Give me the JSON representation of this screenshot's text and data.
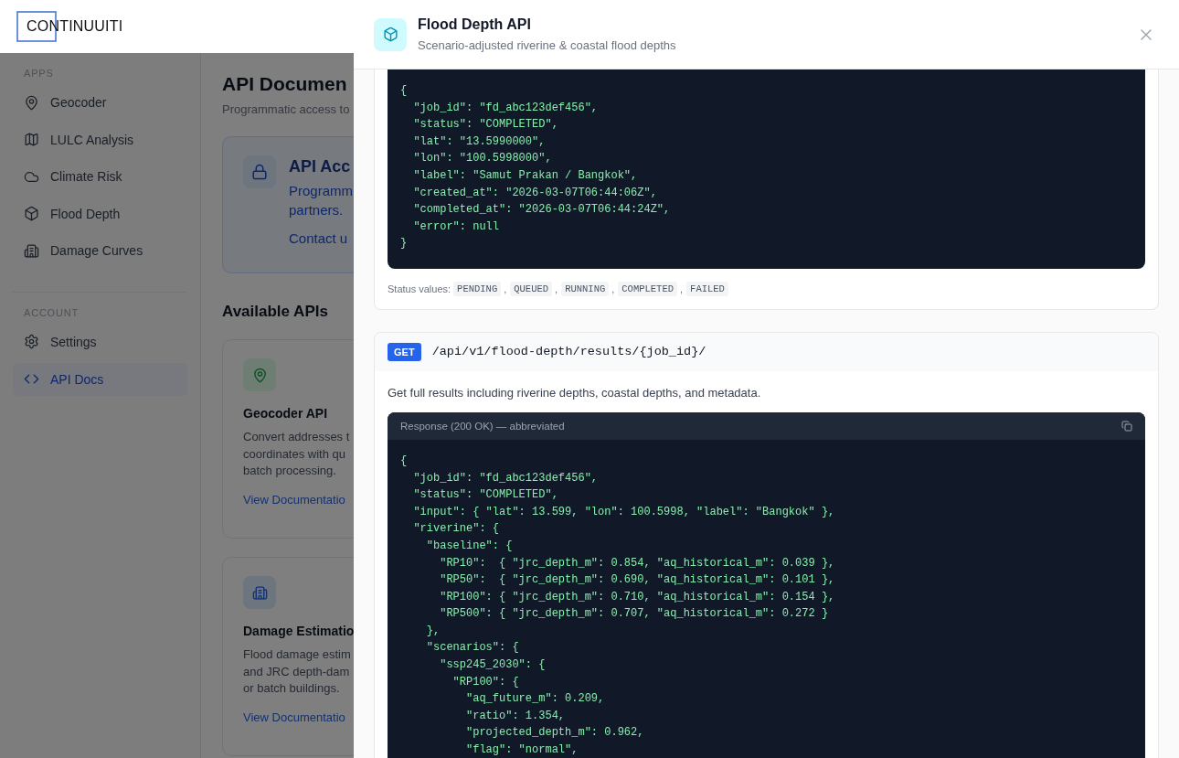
{
  "logo": {
    "text": "CONTINUUITI"
  },
  "sidebar": {
    "sections": [
      {
        "title": "APPS",
        "items": [
          {
            "label": "Geocoder",
            "kind": "pin",
            "selected": false
          },
          {
            "label": "LULC Analysis",
            "kind": "map",
            "selected": false
          },
          {
            "label": "Climate Risk",
            "kind": "cloud",
            "selected": false
          },
          {
            "label": "Flood Depth",
            "kind": "box",
            "selected": false
          },
          {
            "label": "Damage Curves",
            "kind": "building",
            "selected": false
          }
        ]
      },
      {
        "title": "ACCOUNT",
        "items": [
          {
            "label": "Settings",
            "kind": "gear",
            "selected": false
          },
          {
            "label": "API Docs",
            "kind": "code",
            "selected": true
          }
        ]
      }
    ]
  },
  "main": {
    "title": "API Documen",
    "subtitle": "Programmatic access to",
    "access_card": {
      "title": "API Acc",
      "text_lines": [
        "Programm",
        "partners."
      ],
      "link": "Contact u"
    },
    "section_title": "Available APIs",
    "api_cards": [
      {
        "title": "Geocoder API",
        "kind": "pin",
        "description_lines": [
          "Convert addresses t",
          "coordinates with qu",
          "batch processing."
        ],
        "link": "View Documentatio"
      },
      {
        "title": "Damage Estimatio",
        "kind": "building",
        "description_lines": [
          "Flood damage estim",
          "and JRC depth-dam",
          "or batch buildings."
        ],
        "link": "View Documentatio"
      }
    ]
  },
  "drawer": {
    "title": "Flood Depth API",
    "subtitle": "Scenario-adjusted riverine & coastal flood depths",
    "endpoints": [
      {
        "code_lines": [
          "{",
          "  \"job_id\": \"fd_abc123def456\",",
          "  \"status\": \"COMPLETED\",",
          "  \"lat\": \"13.5990000\",",
          "  \"lon\": \"100.5998000\",",
          "  \"label\": \"Samut Prakan / Bangkok\",",
          "  \"created_at\": \"2026-03-07T06:44:06Z\",",
          "  \"completed_at\": \"2026-03-07T06:44:24Z\",",
          "  \"error\": null",
          "}"
        ],
        "status_label": "Status values:",
        "separator": ",",
        "status_values": [
          "PENDING",
          "QUEUED",
          "RUNNING",
          "COMPLETED",
          "FAILED"
        ]
      },
      {
        "method": "GET",
        "path": "/api/v1/flood-depth/results/{job_id}/",
        "description": "Get full results including riverine depths, coastal depths, and metadata.",
        "response_title": "Response (200 OK) — abbreviated",
        "code_lines": [
          "{",
          "  \"job_id\": \"fd_abc123def456\",",
          "  \"status\": \"COMPLETED\",",
          "  \"input\": { \"lat\": 13.599, \"lon\": 100.5998, \"label\": \"Bangkok\" },",
          "  \"riverine\": {",
          "    \"baseline\": {",
          "      \"RP10\":  { \"jrc_depth_m\": 0.854, \"aq_historical_m\": 0.039 },",
          "      \"RP50\":  { \"jrc_depth_m\": 0.690, \"aq_historical_m\": 0.101 },",
          "      \"RP100\": { \"jrc_depth_m\": 0.710, \"aq_historical_m\": 0.154 },",
          "      \"RP500\": { \"jrc_depth_m\": 0.707, \"aq_historical_m\": 0.272 }",
          "    },",
          "    \"scenarios\": {",
          "      \"ssp245_2030\": {",
          "        \"RP100\": {",
          "          \"aq_future_m\": 0.209,",
          "          \"ratio\": 1.354,",
          "          \"projected_depth_m\": 0.962,",
          "          \"flag\": \"normal\","
        ]
      }
    ]
  }
}
